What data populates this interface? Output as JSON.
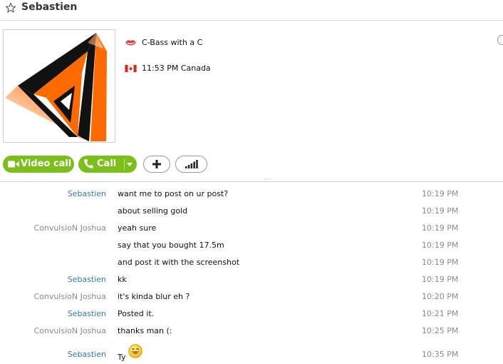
{
  "header": {
    "contact_name": "Sebastien",
    "star_icon": "star-icon"
  },
  "profile": {
    "mood": "C-Bass with a C",
    "mood_icon": "skype-lips-icon",
    "location": "11:53 PM Canada",
    "location_icon": "canada-flag-icon"
  },
  "actions": {
    "video_call_label": "Video call",
    "call_label": "Call",
    "plus_icon": "plus-icon",
    "signal_icon": "signal-bars-icon"
  },
  "colors": {
    "accent_green": "#7cbf1a",
    "sender_me": "#2e7bb8",
    "sender_other": "#8a8a8a"
  },
  "messages": [
    {
      "sender": "Sebastien",
      "text": "want me to post on ur post?",
      "time": "10:19 PM"
    },
    {
      "sender": "",
      "text": "about selling gold",
      "time": "10:19 PM"
    },
    {
      "sender": "ConvulsioN Joshua",
      "text": "yeah sure",
      "time": "10:19 PM"
    },
    {
      "sender": "",
      "text": "say that you bought 17.5m",
      "time": "10:19 PM"
    },
    {
      "sender": "",
      "text": "and post it with the screenshot",
      "time": "10:19 PM"
    },
    {
      "sender": "Sebastien",
      "text": "kk",
      "time": "10:19 PM"
    },
    {
      "sender": "ConvulsioN Joshua",
      "text": "it's kinda blur eh ?",
      "time": "10:20 PM"
    },
    {
      "sender": "Sebastien",
      "text": "Posted it.",
      "time": "10:21 PM"
    },
    {
      "sender": "ConvulsioN Joshua",
      "text": "thanks man (:",
      "time": "10:25 PM"
    },
    {
      "sender": "Sebastien",
      "text": "Ty",
      "time": "10:35 PM",
      "emoticon": "laughing-smiley-icon"
    }
  ]
}
